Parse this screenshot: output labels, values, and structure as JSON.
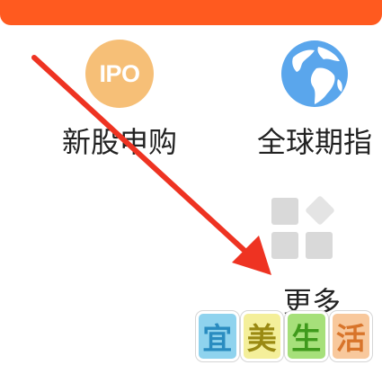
{
  "header": {
    "accent_color": "#ff5a1f"
  },
  "shortcuts": [
    {
      "label": "新股申购",
      "icon": "ipo-icon",
      "icon_text": "IPO",
      "icon_color": "#f6bf77"
    },
    {
      "label": "全球期指",
      "icon": "globe-icon",
      "icon_color": "#5aa6ec"
    },
    {
      "label": "更多",
      "icon": "grid-more-icon",
      "icon_color": "#d9d9d9"
    }
  ],
  "annotation": {
    "arrow_color": "#ee3322",
    "arrow_points_to": "更多"
  },
  "watermark": {
    "chars": [
      "宜",
      "美",
      "生",
      "活"
    ]
  }
}
